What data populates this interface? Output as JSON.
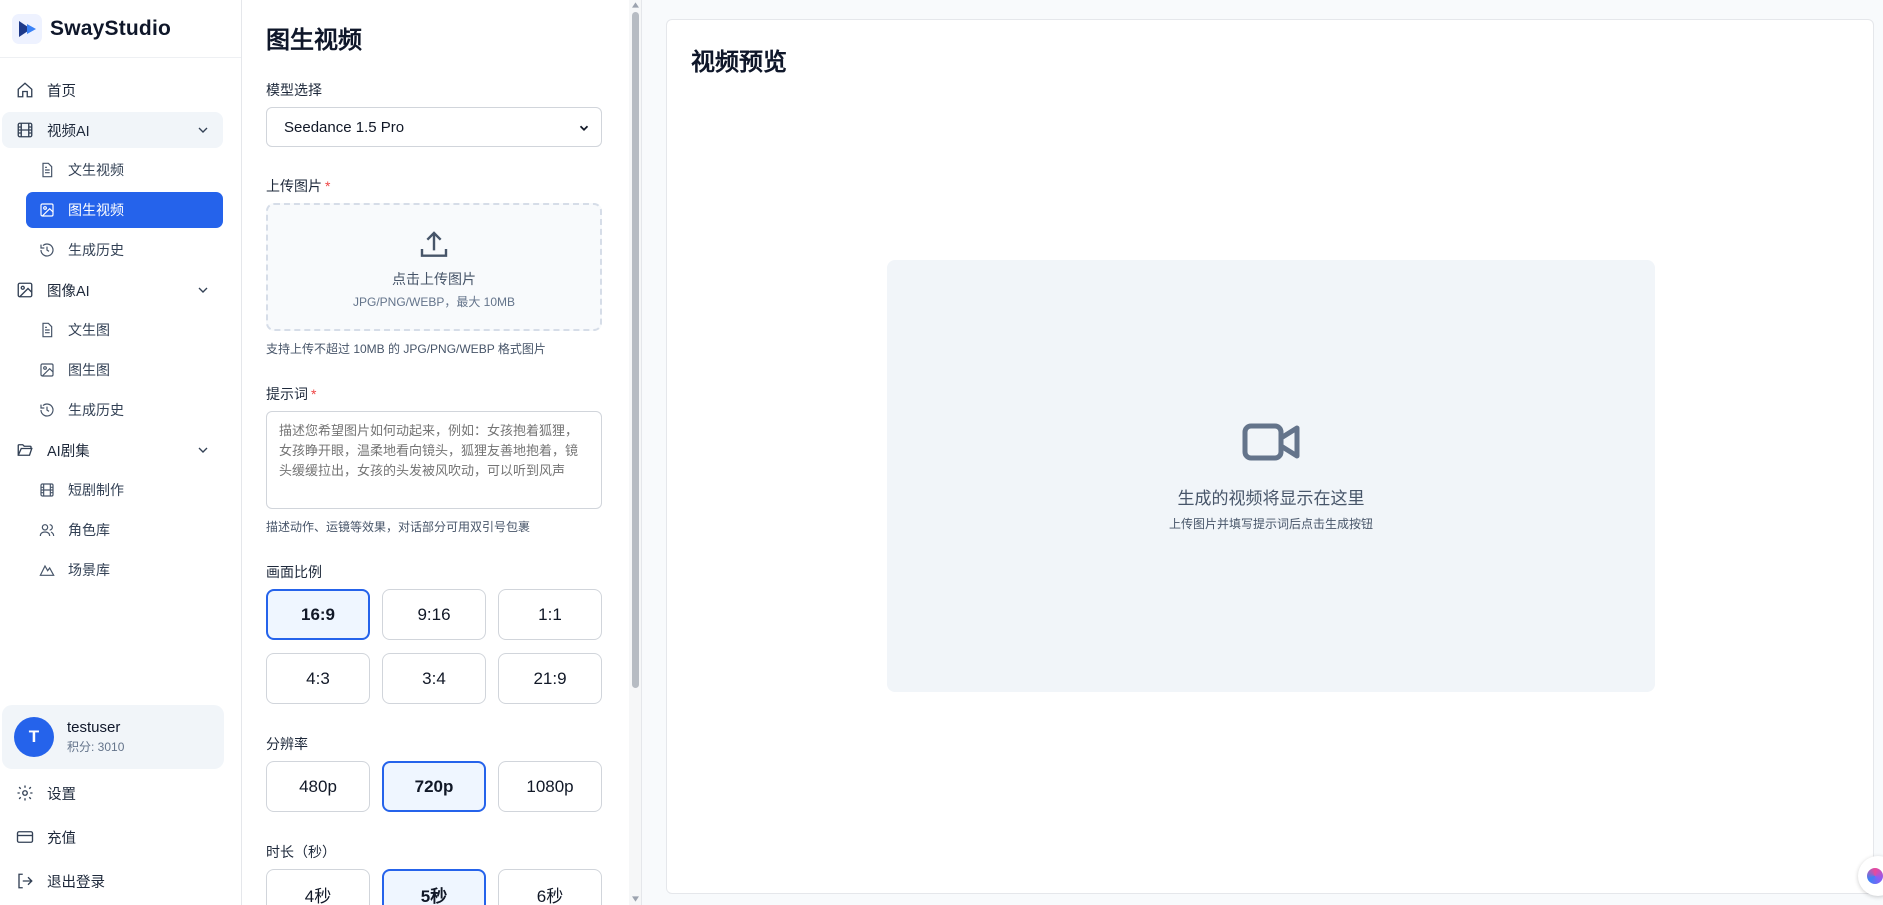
{
  "brand": {
    "name": "SwayStudio"
  },
  "sidebar": {
    "home": "首页",
    "groups": [
      {
        "label": "视频AI",
        "items": [
          "文生视频",
          "图生视频",
          "生成历史"
        ]
      },
      {
        "label": "图像AI",
        "items": [
          "文生图",
          "图生图",
          "生成历史"
        ]
      },
      {
        "label": "AI剧集",
        "items": [
          "短剧制作",
          "角色库",
          "场景库"
        ]
      }
    ],
    "active_item": "图生视频"
  },
  "user": {
    "avatar_letter": "T",
    "name": "testuser",
    "points": "积分: 3010"
  },
  "bottom_nav": {
    "settings": "设置",
    "recharge": "充值",
    "logout": "退出登录"
  },
  "form": {
    "title": "图生视频",
    "model_label": "模型选择",
    "model_value": "Seedance 1.5 Pro",
    "upload_label": "上传图片",
    "upload_title": "点击上传图片",
    "upload_hint": "JPG/PNG/WEBP，最大 10MB",
    "upload_help": "支持上传不超过 10MB 的 JPG/PNG/WEBP 格式图片",
    "prompt_label": "提示词",
    "prompt_placeholder": "描述您希望图片如何动起来，例如：女孩抱着狐狸，女孩睁开眼，温柔地看向镜头，狐狸友善地抱着，镜头缓缓拉出，女孩的头发被风吹动，可以听到风声",
    "prompt_help": "描述动作、运镜等效果，对话部分可用双引号包裹",
    "ratio_label": "画面比例",
    "ratios": [
      "16:9",
      "9:16",
      "1:1",
      "4:3",
      "3:4",
      "21:9"
    ],
    "ratio_selected": "16:9",
    "resolution_label": "分辨率",
    "resolutions": [
      "480p",
      "720p",
      "1080p"
    ],
    "resolution_selected": "720p",
    "duration_label": "时长（秒）",
    "durations": [
      "4秒",
      "5秒",
      "6秒"
    ],
    "duration_selected": "5秒"
  },
  "preview": {
    "title": "视频预览",
    "empty_title": "生成的视频将显示在这里",
    "empty_hint": "上传图片并填写提示词后点击生成按钮"
  },
  "colors": {
    "accent": "#2563eb",
    "required": "#ef4444"
  }
}
